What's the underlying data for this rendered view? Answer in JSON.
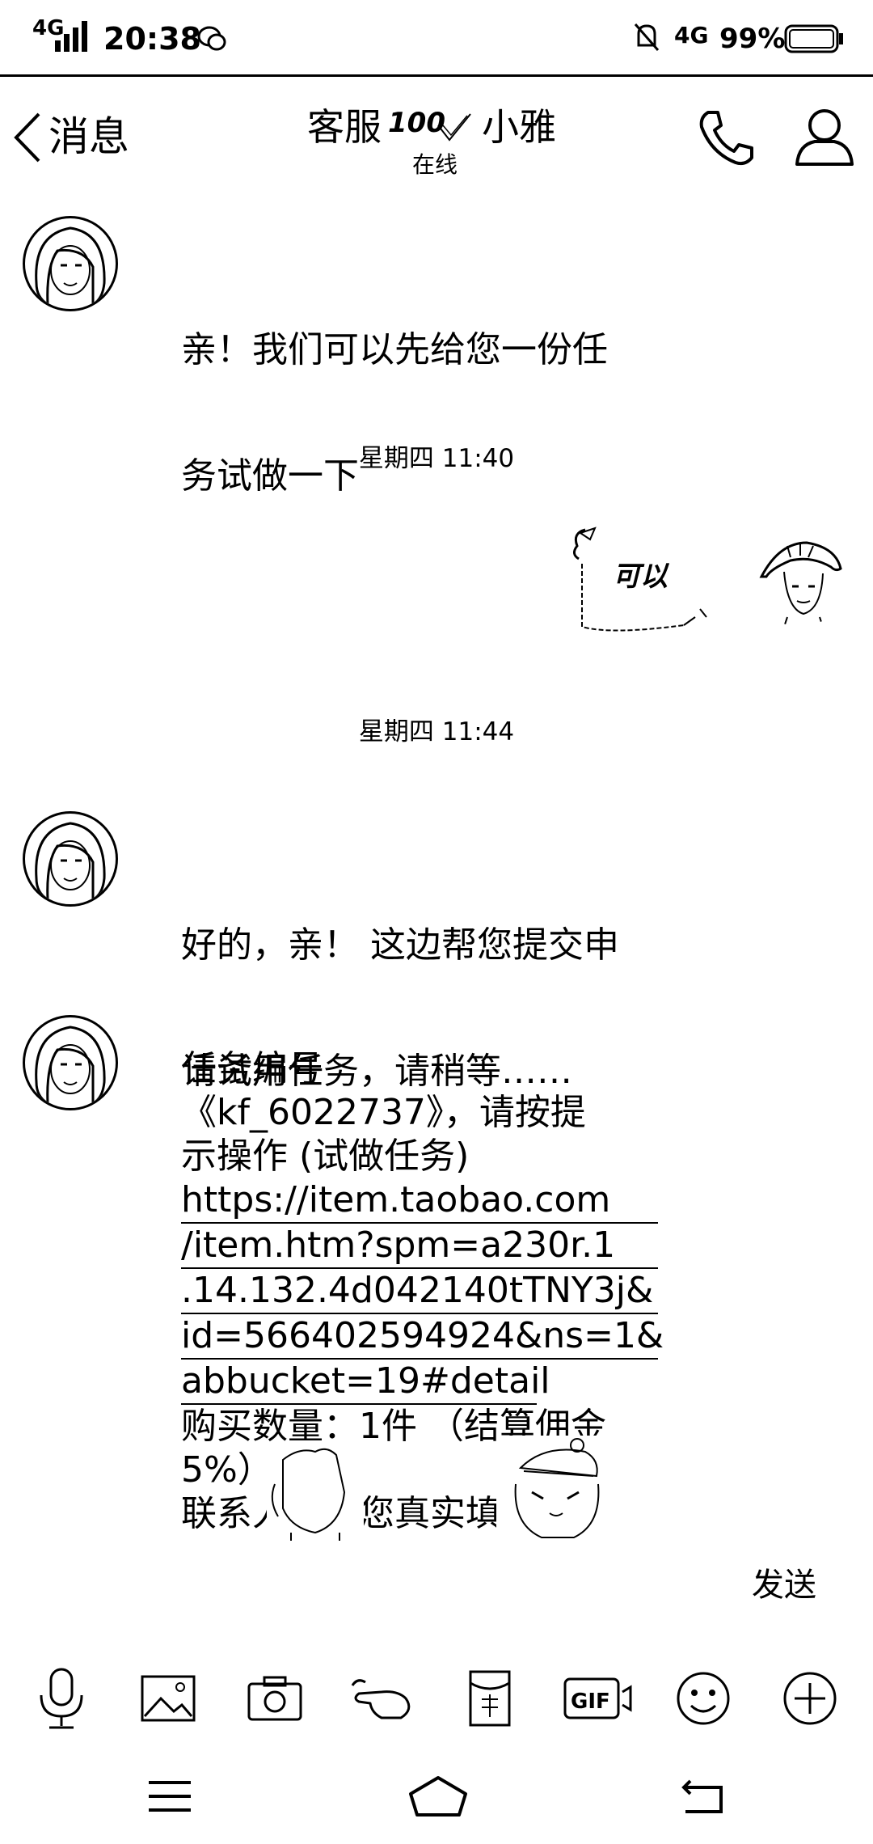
{
  "status_bar": {
    "network_left": "4G",
    "time": "20:38",
    "network_right": "4G",
    "battery": "99%"
  },
  "header": {
    "back_label": "消息",
    "title_prefix": "客服",
    "title_badge": "100",
    "title_name": "小雅",
    "status": "在线"
  },
  "messages": {
    "m1": {
      "line1": "亲！我们可以先给您一份任",
      "line2": "务试做一下"
    },
    "time1": "星期四 11:40",
    "sticker_text": "可以",
    "time2": "星期四 11:44",
    "m2": {
      "line1": "好的，亲！ 这边帮您提交申",
      "line2": "请试用任务，请稍等……"
    },
    "m3": {
      "l1": "任务编号",
      "l2": "《kf_6022737》，请按提",
      "l3": "示操作 (试做任务)",
      "link1": "https://item.taobao.com",
      "link2": "/item.htm?spm=a230r.1",
      "link3": ".14.132.4d042140tTNY3j&",
      "link4": "id=566402594924&ns=1&",
      "link5": "abbucket=19#detail",
      "l4": "购买数量：1件 （结算佣金",
      "l5": "5%）",
      "l6": "联系人，请您真实填"
    }
  },
  "composer": {
    "send_label": "发送"
  },
  "toolbar_icons": [
    "microphone-icon",
    "image-icon",
    "camera-icon",
    "hand-poke-icon",
    "red-packet-icon",
    "gif-icon",
    "emoji-icon",
    "plus-icon"
  ],
  "nav_icons": [
    "menu-icon",
    "home-icon",
    "back-icon"
  ],
  "colors": {
    "foreground": "#000000",
    "background": "#ffffff"
  }
}
